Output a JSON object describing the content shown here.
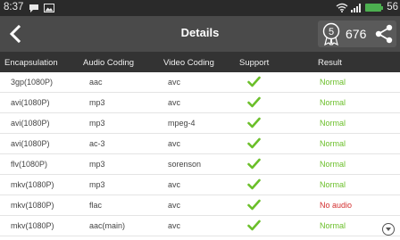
{
  "status_bar": {
    "time": "8:37",
    "battery_percent": "56",
    "icons": [
      "chat-icon",
      "image-icon",
      "wifi-icon",
      "signal-icon",
      "battery-icon"
    ]
  },
  "app_bar": {
    "title": "Details",
    "points": "676",
    "medal_number": "5",
    "back_icon": "chevron-left-icon",
    "share_icon": "share-icon"
  },
  "table": {
    "headers": [
      "Encapsulation",
      "Audio Coding",
      "Video Coding",
      "Support",
      "Result"
    ],
    "rows": [
      {
        "encapsulation": "3gp(1080P)",
        "audio": "aac",
        "video": "avc",
        "support": "check",
        "result": "Normal",
        "result_color": "#6bbf2a"
      },
      {
        "encapsulation": "avi(1080P)",
        "audio": "mp3",
        "video": "avc",
        "support": "check",
        "result": "Normal",
        "result_color": "#6bbf2a"
      },
      {
        "encapsulation": "avi(1080P)",
        "audio": "mp3",
        "video": "mpeg-4",
        "support": "check",
        "result": "Normal",
        "result_color": "#6bbf2a"
      },
      {
        "encapsulation": "avi(1080P)",
        "audio": "ac-3",
        "video": "avc",
        "support": "check",
        "result": "Normal",
        "result_color": "#6bbf2a"
      },
      {
        "encapsulation": "flv(1080P)",
        "audio": "mp3",
        "video": "sorenson",
        "support": "check",
        "result": "Normal",
        "result_color": "#6bbf2a"
      },
      {
        "encapsulation": "mkv(1080P)",
        "audio": "mp3",
        "video": "avc",
        "support": "check",
        "result": "Normal",
        "result_color": "#6bbf2a"
      },
      {
        "encapsulation": "mkv(1080P)",
        "audio": "flac",
        "video": "avc",
        "support": "check",
        "result": "No audio",
        "result_color": "#d32f2f"
      },
      {
        "encapsulation": "mkv(1080P)",
        "audio": "aac(main)",
        "video": "avc",
        "support": "check",
        "result": "Normal",
        "result_color": "#6bbf2a"
      }
    ]
  },
  "colors": {
    "status_bar_bg": "#2a2a2a",
    "app_bar_bg": "#4a4a4a",
    "header_bg": "#333333",
    "check_green": "#6bbf2a",
    "error_red": "#d32f2f"
  }
}
